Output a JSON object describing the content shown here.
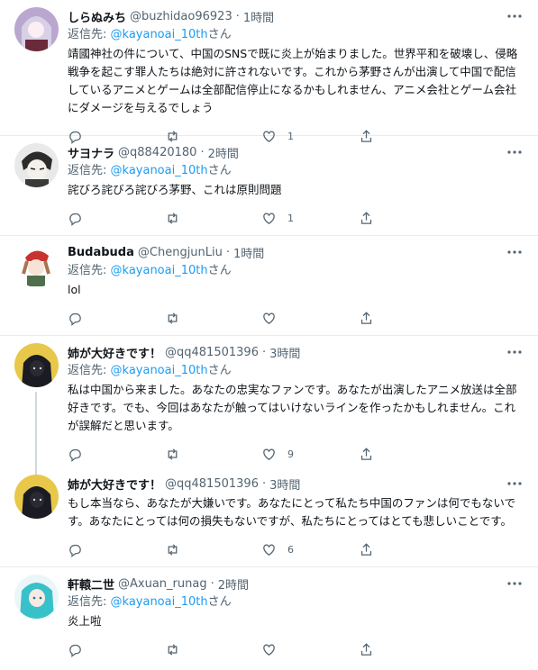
{
  "colors": {
    "link": "#1d9bf0",
    "muted": "#536471",
    "border": "#e6ecf0"
  },
  "tweets": [
    {
      "name": "しらぬみち",
      "handle": "@buzhidao96923",
      "dot": "·",
      "time": "1時間",
      "reply_prefix": "返信先: ",
      "reply_mention": "@kayanoai_10th",
      "reply_suffix": "さん",
      "text": "靖國神社の件について、中国のSNSで既に炎上が始まりました。世界平和を破壊し、侵略戦争を起こす罪人たちは絶対に許されないです。これから茅野さんが出演して中国で配信しているアニメとゲームは全部配信停止になるかもしれません、アニメ会社とゲーム会社にダメージを与えるでしょう",
      "likes": "1"
    },
    {
      "name": "サヨナラ",
      "handle": "@q88420180",
      "dot": "·",
      "time": "2時間",
      "reply_prefix": "返信先: ",
      "reply_mention": "@kayanoai_10th",
      "reply_suffix": "さん",
      "text": "詫びろ詫びろ詫びろ茅野、これは原則問題",
      "likes": "1"
    },
    {
      "name": "Budabuda",
      "handle": "@ChengjunLiu",
      "dot": "·",
      "time": "1時間",
      "reply_prefix": "返信先: ",
      "reply_mention": "@kayanoai_10th",
      "reply_suffix": "さん",
      "text": "lol",
      "likes": ""
    },
    {
      "name": "姉が大好きです！",
      "handle": "@qq481501396",
      "dot": "·",
      "time": "3時間",
      "reply_prefix": "返信先: ",
      "reply_mention": "@kayanoai_10th",
      "reply_suffix": "さん",
      "text": "私は中国から来ました。あなたの忠実なファンです。あなたが出演したアニメ放送は全部好きです。でも、今回はあなたが触ってはいけないラインを作ったかもしれません。これが誤解だと思います。",
      "likes": "9"
    },
    {
      "name": "姉が大好きです！",
      "handle": "@qq481501396",
      "dot": "·",
      "time": "3時間",
      "text": "もし本当なら、あなたが大嫌いです。あなたにとって私たち中国のファンは何でもないです。あなたにとっては何の損失もないですが、私たちにとってはとても悲しいことです。",
      "likes": "6"
    },
    {
      "name": "軒轅二世",
      "handle": "@Axuan_runag",
      "dot": "·",
      "time": "2時間",
      "reply_prefix": "返信先: ",
      "reply_mention": "@kayanoai_10th",
      "reply_suffix": "さん",
      "text": "炎上啦",
      "likes": ""
    }
  ]
}
